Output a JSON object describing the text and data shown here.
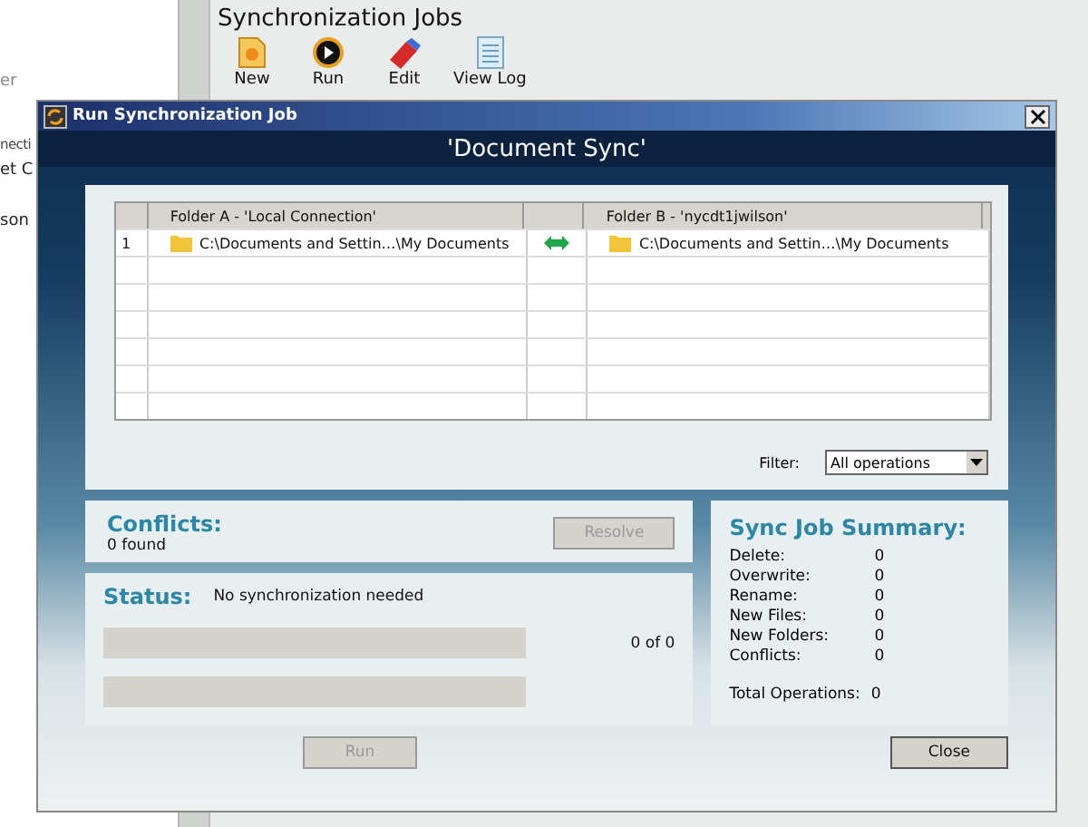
{
  "background": {
    "sidebar_texts": [
      "er",
      "necti",
      "et C",
      "son"
    ],
    "title": "Synchronization Jobs",
    "toolbar": [
      {
        "label": "New",
        "kind": "new"
      },
      {
        "label": "Run",
        "kind": "run"
      },
      {
        "label": "Edit",
        "kind": "edit"
      },
      {
        "label": "View Log",
        "kind": "log"
      }
    ]
  },
  "dialog": {
    "title": "Run Synchronization Job",
    "heading": "'Document Sync'",
    "table": {
      "columns": [
        "Folder A - 'Local Connection'",
        "Folder B - 'nycdt1jwilson'"
      ],
      "rows": [
        {
          "number": "1",
          "folder_a": "C:\\Documents and Settin…\\My Documents",
          "folder_b": "C:\\Documents and Settin…\\My Documents"
        }
      ]
    },
    "filter": {
      "label": "Filter:",
      "value": "All operations"
    },
    "conflicts": {
      "title": "Conflicts:",
      "count": "0 found",
      "button": {
        "label": "Resolve",
        "disabled": true
      }
    },
    "status": {
      "title": "Status:",
      "message": "No synchronization needed",
      "progress": [
        {
          "level": 0,
          "reading": "0 of 0"
        },
        {
          "level": 0
        }
      ]
    },
    "summary": {
      "title": "Sync Job Summary:",
      "items": [
        {
          "label": "Delete:",
          "value": "0"
        },
        {
          "label": "Overwrite:",
          "value": "0"
        },
        {
          "label": "Rename:",
          "value": "0"
        },
        {
          "label": "New Files:",
          "value": "0"
        },
        {
          "label": "New Folders:",
          "value": "0"
        },
        {
          "label": "Conflicts:",
          "value": "0"
        }
      ],
      "total": {
        "label": "Total Operations:",
        "value": "0"
      }
    },
    "buttons": [
      {
        "label": "Run",
        "disabled": true
      },
      {
        "label": "Close",
        "disabled": false
      }
    ]
  }
}
